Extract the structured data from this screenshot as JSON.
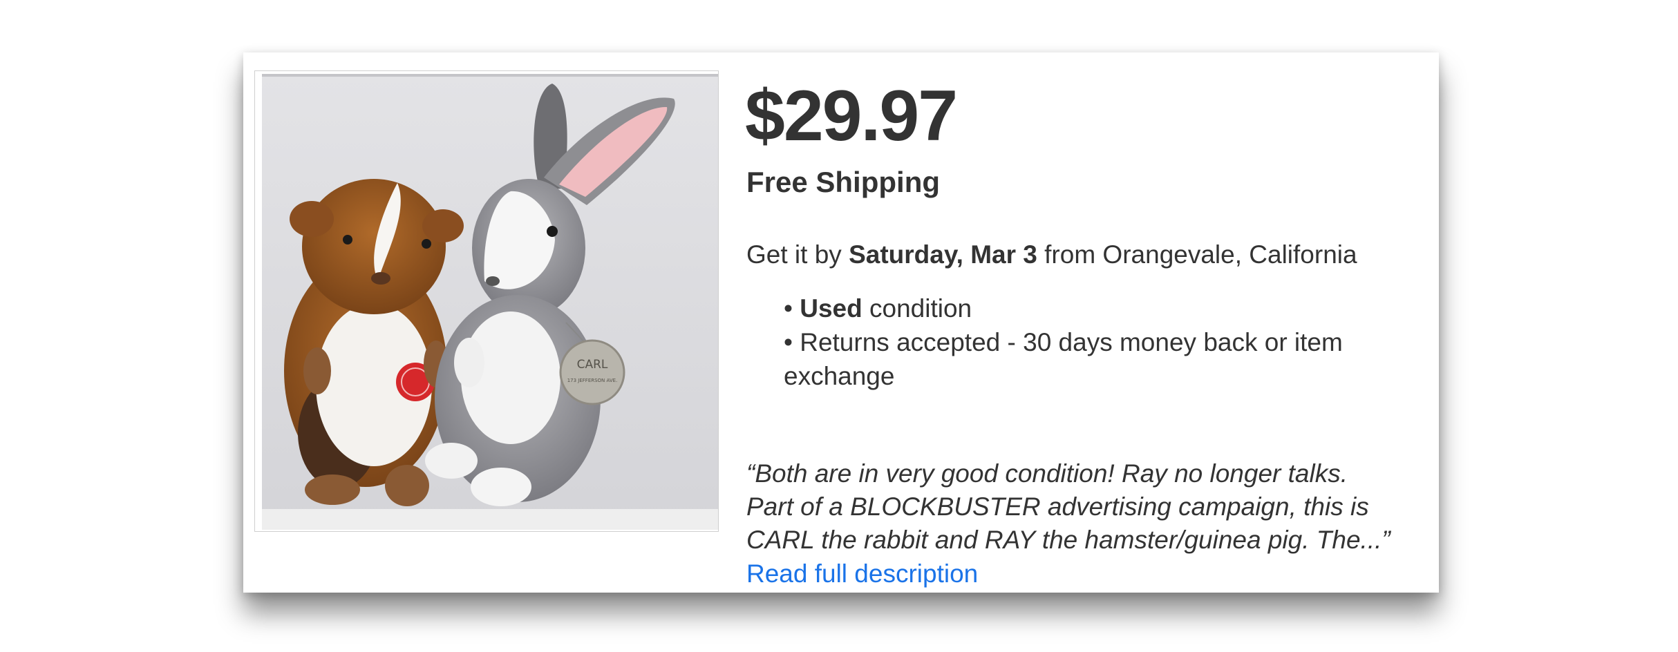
{
  "listing": {
    "photo_alt": "Plush guinea pig and plush rabbit",
    "tag_text": "CARL",
    "tag_subtext": "173 JEFFERSON AVE.",
    "price": "$29.97",
    "shipping": "Free Shipping",
    "delivery": {
      "prefix": "Get it by ",
      "date": "Saturday, Mar 3",
      "suffix": " from Orangevale, California"
    },
    "bullets": [
      {
        "marker": "• ",
        "bold": "Used",
        "text": " condition"
      },
      {
        "marker": "• ",
        "bold": "",
        "text": "Returns accepted - 30 days money back or item exchange"
      }
    ],
    "description_lines": [
      "“Both are in very good condition! Ray no longer talks.",
      "Part of a BLOCKBUSTER advertising campaign, this is",
      "CARL the rabbit and RAY the hamster/guinea pig. The...”"
    ],
    "read_more": "Read full description"
  },
  "colors": {
    "text": "#333333",
    "link": "#1a73e8",
    "card_background": "#ffffff"
  }
}
